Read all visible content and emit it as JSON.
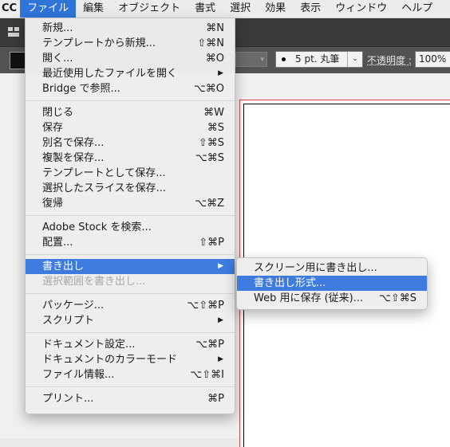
{
  "menubar": {
    "app_name": "CC",
    "items": [
      "ファイル",
      "編集",
      "オブジェクト",
      "書式",
      "選択",
      "効果",
      "表示",
      "ウィンドウ",
      "ヘルプ"
    ]
  },
  "toolbar": {
    "brush_label": "5 pt. 丸筆",
    "brush_arrow": "⌄",
    "opacity_label": "不透明度 :",
    "opacity_value": "100%"
  },
  "file_menu": {
    "new": {
      "label": "新規...",
      "shortcut": "⌘N"
    },
    "new_from_template": {
      "label": "テンプレートから新規...",
      "shortcut": "⇧⌘N"
    },
    "open": {
      "label": "開く...",
      "shortcut": "⌘O"
    },
    "open_recent": {
      "label": "最近使用したファイルを開く"
    },
    "bridge": {
      "label": "Bridge で参照...",
      "shortcut": "⌥⌘O"
    },
    "close": {
      "label": "閉じる",
      "shortcut": "⌘W"
    },
    "save": {
      "label": "保存",
      "shortcut": "⌘S"
    },
    "save_as": {
      "label": "別名で保存...",
      "shortcut": "⇧⌘S"
    },
    "save_copy": {
      "label": "複製を保存...",
      "shortcut": "⌥⌘S"
    },
    "save_template": {
      "label": "テンプレートとして保存..."
    },
    "save_slices": {
      "label": "選択したスライスを保存..."
    },
    "revert": {
      "label": "復帰",
      "shortcut": "⌥⌘Z"
    },
    "adobe_stock": {
      "label": "Adobe Stock を検索..."
    },
    "place": {
      "label": "配置...",
      "shortcut": "⇧⌘P"
    },
    "export": {
      "label": "書き出し"
    },
    "export_selection": {
      "label": "選択範囲を書き出し..."
    },
    "package": {
      "label": "パッケージ...",
      "shortcut": "⌥⇧⌘P"
    },
    "scripts": {
      "label": "スクリプト"
    },
    "document_setup": {
      "label": "ドキュメント設定...",
      "shortcut": "⌥⌘P"
    },
    "color_mode": {
      "label": "ドキュメントのカラーモード"
    },
    "file_info": {
      "label": "ファイル情報...",
      "shortcut": "⌥⇧⌘I"
    },
    "print": {
      "label": "プリント...",
      "shortcut": "⌘P"
    }
  },
  "export_submenu": {
    "export_for_screens": {
      "label": "スクリーン用に書き出し..."
    },
    "export_as": {
      "label": "書き出し形式..."
    },
    "save_for_web": {
      "label": "Web 用に保存 (従来)...",
      "shortcut": "⌥⇧⌘S"
    }
  },
  "colors": {
    "menu_highlight": "#3d7bde",
    "menubar_active": "#2f74d9",
    "app_chrome": "#535353",
    "artboard_bleed": "#d94040"
  }
}
